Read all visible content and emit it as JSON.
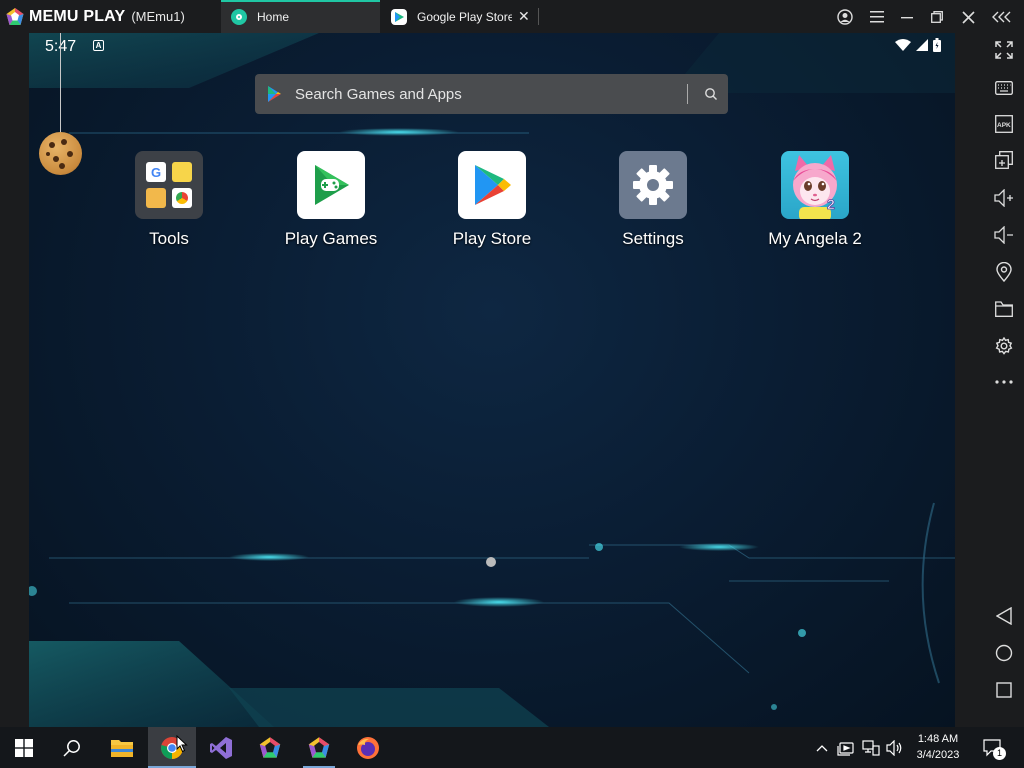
{
  "titlebar": {
    "brand_name": "MEMU PLAY",
    "instance": "(MEmu1)",
    "tabs": [
      {
        "label": "Home",
        "icon": "memu-home-icon",
        "active": true
      },
      {
        "label": "Google Play Store",
        "icon": "play-store-icon",
        "active": false
      }
    ]
  },
  "android": {
    "time": "5:47",
    "search_placeholder": "Search Games and Apps",
    "apps": [
      {
        "label": "Tools",
        "icon": "tools-folder-icon"
      },
      {
        "label": "Play Games",
        "icon": "play-games-icon"
      },
      {
        "label": "Play Store",
        "icon": "play-store-icon"
      },
      {
        "label": "Settings",
        "icon": "settings-gear-icon"
      },
      {
        "label": "My Angela 2",
        "icon": "my-angela-icon"
      }
    ]
  },
  "toolbar": {
    "items": [
      "fullscreen",
      "keyboard",
      "apk-install",
      "multi-window",
      "volume-up",
      "volume-down",
      "location",
      "folder",
      "settings",
      "more",
      "back",
      "home",
      "recents"
    ]
  },
  "taskbar": {
    "clock_time": "1:48 AM",
    "clock_date": "3/4/2023",
    "notification_count": "1"
  },
  "colors": {
    "accent_teal": "#20c7a4",
    "screen_bg": "#0a1d33",
    "titlebar_bg": "#1b1c1e"
  }
}
